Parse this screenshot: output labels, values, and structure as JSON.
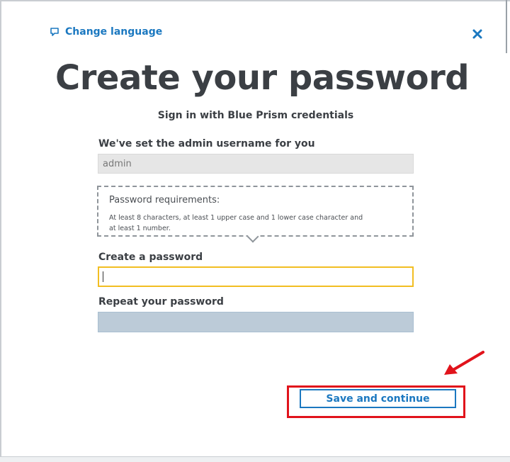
{
  "header": {
    "change_language_label": "Change language",
    "close_icon": "close-icon",
    "chat_icon": "chat-bubble-icon"
  },
  "main": {
    "title": "Create your password",
    "subtitle": "Sign in with Blue Prism credentials"
  },
  "username": {
    "label": "We've set the admin username for you",
    "value": "admin"
  },
  "requirements": {
    "title": "Password requirements:",
    "text": "At least 8 characters, at least 1 upper case and 1 lower case character and at least 1 number."
  },
  "password": {
    "label": "Create a password",
    "value": ""
  },
  "repeat_password": {
    "label": "Repeat your password",
    "value": ""
  },
  "footer": {
    "save_label": "Save and continue"
  },
  "colors": {
    "accent": "#1b78c0",
    "focus_border": "#f2be22",
    "annotation": "#e1131b",
    "title_text": "#3b3f44"
  }
}
